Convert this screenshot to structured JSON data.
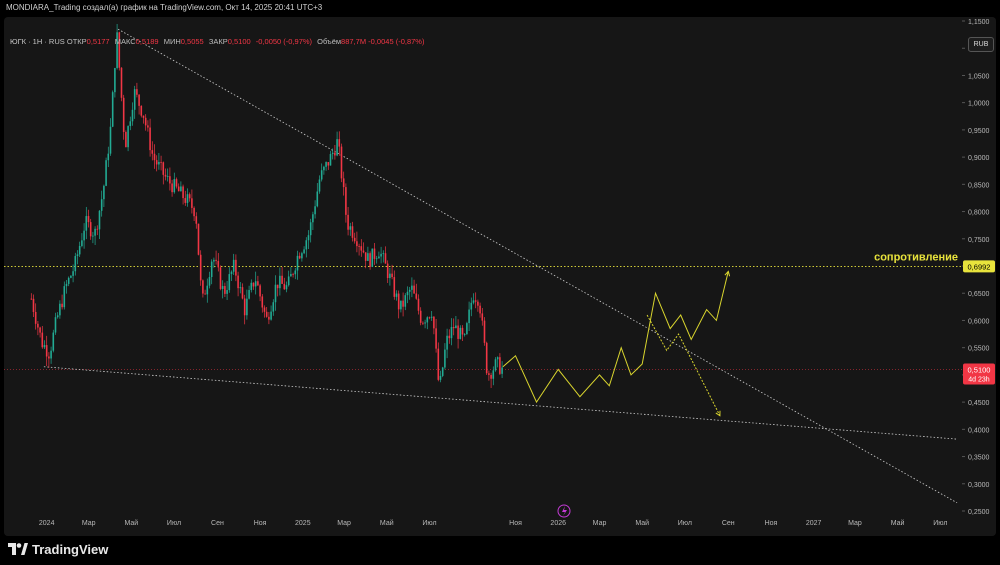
{
  "header": {
    "title": "MONDIARA_Trading создал(а) график на TradingView.com, Окт 14, 2025 20:41 UTC+3"
  },
  "legend": {
    "symbol": "ЮГК · 1Н · RUS",
    "open_label": "ОТКР",
    "open": "0,5177",
    "high_label": "МАКС",
    "high": "0,5189",
    "low_label": "МИН",
    "low": "0,5055",
    "close_label": "ЗАКР",
    "close": "0,5100",
    "change": "-0,0050 (-0,97%)",
    "volume_label": "Объём",
    "volume": "887,7M",
    "volume_change": "-0,0045 (-0,87%)"
  },
  "currency_button": "RUB",
  "footer": {
    "brand": "TradingView"
  },
  "colors": {
    "background": "#161616",
    "up": "#22ab94",
    "down": "#f23645",
    "level": "#e8e33c",
    "projection": "#d9d52e",
    "trend_line": "#cfcfcf"
  },
  "chart_data": {
    "type": "candlestick",
    "symbol": "ЮГК",
    "timeframe": "1H",
    "currency": "RUB",
    "x_range": [
      "2023-11",
      "2027-08"
    ],
    "ylim": [
      0.25,
      1.15
    ],
    "y_ticks": [
      "0,2500",
      "0,3000",
      "0,3500",
      "0,4000",
      "0,4500",
      "0,5000",
      "0,5500",
      "0,6000",
      "0,6500",
      "0,7000",
      "0,7500",
      "0,8000",
      "0,8500",
      "0,9000",
      "0,9500",
      "1,0000",
      "1,0500",
      "1,1000",
      "1,1500"
    ],
    "x_ticks": [
      {
        "t": "2024-01",
        "label": "2024"
      },
      {
        "t": "2024-03",
        "label": "Мар"
      },
      {
        "t": "2024-05",
        "label": "Май"
      },
      {
        "t": "2024-07",
        "label": "Июл"
      },
      {
        "t": "2024-09",
        "label": "Сен"
      },
      {
        "t": "2024-11",
        "label": "Ноя"
      },
      {
        "t": "2025-01",
        "label": "2025"
      },
      {
        "t": "2025-03",
        "label": "Мар"
      },
      {
        "t": "2025-05",
        "label": "Май"
      },
      {
        "t": "2025-07",
        "label": "Июл"
      },
      {
        "t": "2025-11",
        "label": "Ноя"
      },
      {
        "t": "2026-01",
        "label": "2026"
      },
      {
        "t": "2026-03",
        "label": "Мар"
      },
      {
        "t": "2026-05",
        "label": "Май"
      },
      {
        "t": "2026-07",
        "label": "Июл"
      },
      {
        "t": "2026-09",
        "label": "Сен"
      },
      {
        "t": "2026-11",
        "label": "Ноя"
      },
      {
        "t": "2027-01",
        "label": "2027"
      },
      {
        "t": "2027-03",
        "label": "Мар"
      },
      {
        "t": "2027-05",
        "label": "Май"
      },
      {
        "t": "2027-07",
        "label": "Июл"
      }
    ],
    "price_path": [
      [
        "2023-12-10",
        0.64
      ],
      [
        "2023-12-25",
        0.56
      ],
      [
        "2024-01-05",
        0.54
      ],
      [
        "2024-01-15",
        0.6
      ],
      [
        "2024-01-28",
        0.66
      ],
      [
        "2024-02-10",
        0.7
      ],
      [
        "2024-02-25",
        0.78
      ],
      [
        "2024-03-10",
        0.76
      ],
      [
        "2024-03-22",
        0.84
      ],
      [
        "2024-04-02",
        0.96
      ],
      [
        "2024-04-10",
        1.13
      ],
      [
        "2024-04-22",
        0.92
      ],
      [
        "2024-05-05",
        1.02
      ],
      [
        "2024-05-18",
        0.98
      ],
      [
        "2024-06-01",
        0.9
      ],
      [
        "2024-06-20",
        0.86
      ],
      [
        "2024-07-05",
        0.84
      ],
      [
        "2024-07-20",
        0.82
      ],
      [
        "2024-08-01",
        0.8
      ],
      [
        "2024-08-10",
        0.63
      ],
      [
        "2024-08-25",
        0.72
      ],
      [
        "2024-09-10",
        0.65
      ],
      [
        "2024-09-25",
        0.7
      ],
      [
        "2024-10-10",
        0.62
      ],
      [
        "2024-10-25",
        0.68
      ],
      [
        "2024-11-10",
        0.6
      ],
      [
        "2024-11-25",
        0.67
      ],
      [
        "2024-12-10",
        0.66
      ],
      [
        "2024-12-25",
        0.72
      ],
      [
        "2025-01-10",
        0.76
      ],
      [
        "2025-01-25",
        0.86
      ],
      [
        "2025-02-10",
        0.9
      ],
      [
        "2025-02-20",
        0.93
      ],
      [
        "2025-03-05",
        0.78
      ],
      [
        "2025-03-20",
        0.75
      ],
      [
        "2025-04-05",
        0.71
      ],
      [
        "2025-04-20",
        0.73
      ],
      [
        "2025-05-05",
        0.68
      ],
      [
        "2025-05-20",
        0.62
      ],
      [
        "2025-06-05",
        0.66
      ],
      [
        "2025-06-20",
        0.6
      ],
      [
        "2025-07-05",
        0.62
      ],
      [
        "2025-07-15",
        0.47
      ],
      [
        "2025-07-25",
        0.56
      ],
      [
        "2025-08-05",
        0.59
      ],
      [
        "2025-08-20",
        0.56
      ],
      [
        "2025-09-01",
        0.65
      ],
      [
        "2025-09-10",
        0.64
      ],
      [
        "2025-09-22",
        0.5
      ],
      [
        "2025-10-05",
        0.52
      ],
      [
        "2025-10-14",
        0.51
      ]
    ],
    "last_price": "0,5100",
    "time_to_close": "4d 23h",
    "resistance": {
      "value": 0.6992,
      "label_price": "0,6992",
      "label": "сопротивление"
    },
    "upper_trendline": [
      [
        "2024-04-12",
        1.135
      ],
      [
        "2027-07-25",
        0.265
      ]
    ],
    "lower_trendline": [
      [
        "2023-12-28",
        0.515
      ],
      [
        "2027-07-25",
        0.382
      ]
    ],
    "projection_main": [
      [
        "2025-10-14",
        0.515
      ],
      [
        "2025-11-01",
        0.535
      ],
      [
        "2025-12-01",
        0.45
      ],
      [
        "2026-01-01",
        0.51
      ],
      [
        "2026-02-01",
        0.46
      ],
      [
        "2026-03-01",
        0.5
      ],
      [
        "2026-03-15",
        0.48
      ],
      [
        "2026-04-01",
        0.55
      ],
      [
        "2026-04-15",
        0.5
      ],
      [
        "2026-05-01",
        0.52
      ],
      [
        "2026-05-20",
        0.65
      ],
      [
        "2026-06-10",
        0.585
      ],
      [
        "2026-06-25",
        0.61
      ],
      [
        "2026-07-10",
        0.565
      ],
      [
        "2026-08-01",
        0.62
      ],
      [
        "2026-08-15",
        0.6
      ],
      [
        "2026-09-01",
        0.69
      ]
    ],
    "projection_alt": [
      [
        "2026-05-08",
        0.61
      ],
      [
        "2026-06-05",
        0.545
      ],
      [
        "2026-06-22",
        0.575
      ],
      [
        "2026-08-20",
        0.425
      ]
    ]
  }
}
